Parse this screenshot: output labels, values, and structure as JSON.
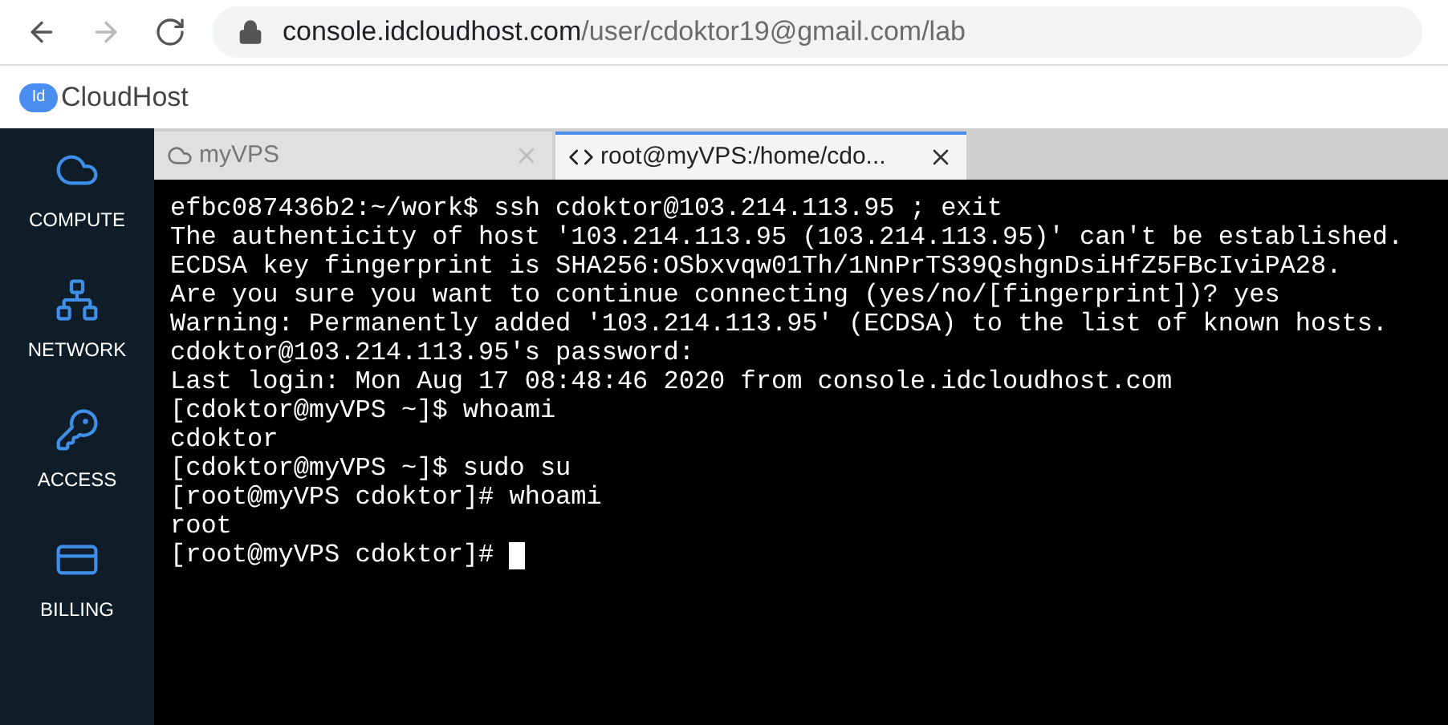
{
  "browser": {
    "url_host": "console.idcloudhost.com",
    "url_path": "/user/cdoktor19@gmail.com/lab"
  },
  "logo": {
    "badge": "Id",
    "name": "CloudHost"
  },
  "sidebar": {
    "items": [
      {
        "kind": "cloud",
        "label": "COMPUTE"
      },
      {
        "kind": "network",
        "label": "NETWORK"
      },
      {
        "kind": "key",
        "label": "ACCESS"
      },
      {
        "kind": "card",
        "label": "BILLING"
      }
    ]
  },
  "tabs": [
    {
      "kind": "cloud",
      "label": "myVPS",
      "selected": false
    },
    {
      "kind": "code",
      "label": "root@myVPS:/home/cdo...",
      "selected": true
    }
  ],
  "terminal": {
    "lines": [
      "efbc087436b2:~/work$ ssh cdoktor@103.214.113.95 ; exit",
      "The authenticity of host '103.214.113.95 (103.214.113.95)' can't be established.",
      "ECDSA key fingerprint is SHA256:OSbxvqw01Th/1NnPrTS39QshgnDsiHfZ5FBcIviPA28.",
      "Are you sure you want to continue connecting (yes/no/[fingerprint])? yes",
      "Warning: Permanently added '103.214.113.95' (ECDSA) to the list of known hosts.",
      "cdoktor@103.214.113.95's password:",
      "Last login: Mon Aug 17 08:48:46 2020 from console.idcloudhost.com",
      "[cdoktor@myVPS ~]$ whoami",
      "cdoktor",
      "[cdoktor@myVPS ~]$ sudo su",
      "[root@myVPS cdoktor]# whoami",
      "root"
    ],
    "prompt": "[root@myVPS cdoktor]# "
  }
}
